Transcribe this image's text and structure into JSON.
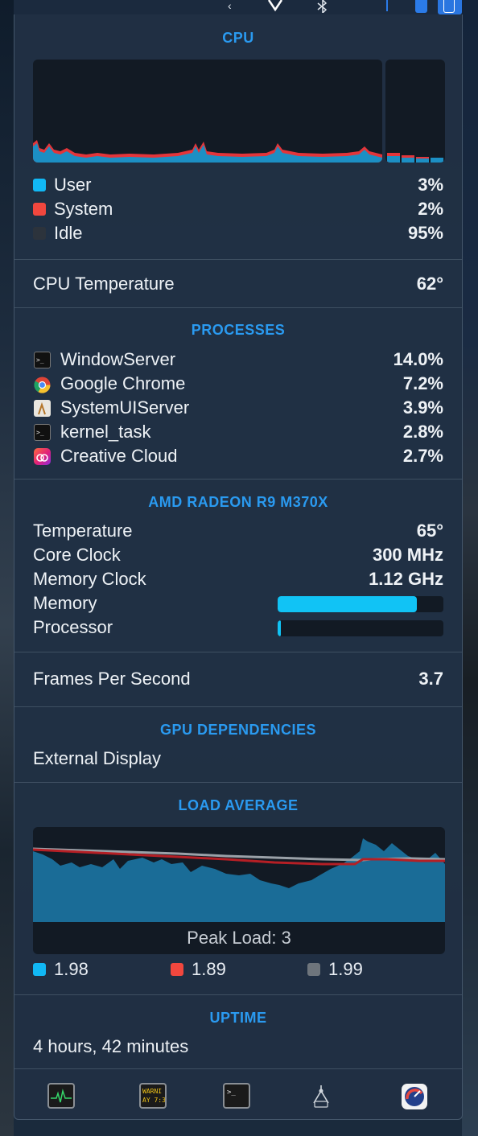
{
  "cpu": {
    "title": "CPU",
    "legend": [
      {
        "label": "User",
        "value": "3%",
        "color": "#11b8f5"
      },
      {
        "label": "System",
        "value": "2%",
        "color": "#f1473e"
      },
      {
        "label": "Idle",
        "value": "95%",
        "color": "#2c333c"
      }
    ],
    "temperature_label": "CPU Temperature",
    "temperature_value": "62°"
  },
  "processes": {
    "title": "PROCESSES",
    "items": [
      {
        "name": "WindowServer",
        "value": "14.0%",
        "icon": "terminal-icon"
      },
      {
        "name": "Google Chrome",
        "value": "7.2%",
        "icon": "chrome-icon"
      },
      {
        "name": "SystemUIServer",
        "value": "3.9%",
        "icon": "systemuiserver-icon"
      },
      {
        "name": "kernel_task",
        "value": "2.8%",
        "icon": "terminal-icon"
      },
      {
        "name": "Creative Cloud",
        "value": "2.7%",
        "icon": "creative-cloud-icon"
      }
    ]
  },
  "gpu": {
    "title": "AMD RADEON R9 M370X",
    "temperature_label": "Temperature",
    "temperature_value": "65°",
    "core_clock_label": "Core Clock",
    "core_clock_value": "300 MHz",
    "memory_clock_label": "Memory Clock",
    "memory_clock_value": "1.12 GHz",
    "memory_label": "Memory",
    "memory_fraction": 0.84,
    "processor_label": "Processor",
    "processor_fraction": 0.02,
    "bar_color": "#11c3f5"
  },
  "fps": {
    "label": "Frames Per Second",
    "value": "3.7"
  },
  "gpu_dependencies": {
    "title": "GPU DEPENDENCIES",
    "item": "External Display"
  },
  "load_average": {
    "title": "LOAD AVERAGE",
    "peak": "Peak Load: 3",
    "legend": [
      {
        "value": "1.98",
        "color": "#11b8f5"
      },
      {
        "value": "1.89",
        "color": "#f1473e"
      },
      {
        "value": "1.99",
        "color": "#8a9097"
      }
    ]
  },
  "uptime": {
    "title": "UPTIME",
    "value": "4 hours, 42 minutes"
  },
  "footer_icons": [
    "activity-monitor-icon",
    "console-icon",
    "terminal-icon",
    "network-utility-icon",
    "istat-menus-icon"
  ],
  "menubar_icons": [
    "chevron-icon",
    "vee-icon",
    "bluetooth-icon",
    "network-icon",
    "battery-icon"
  ],
  "colors": {
    "accent": "#2a9af0",
    "user": "#11b8f5",
    "system": "#f1473e"
  }
}
